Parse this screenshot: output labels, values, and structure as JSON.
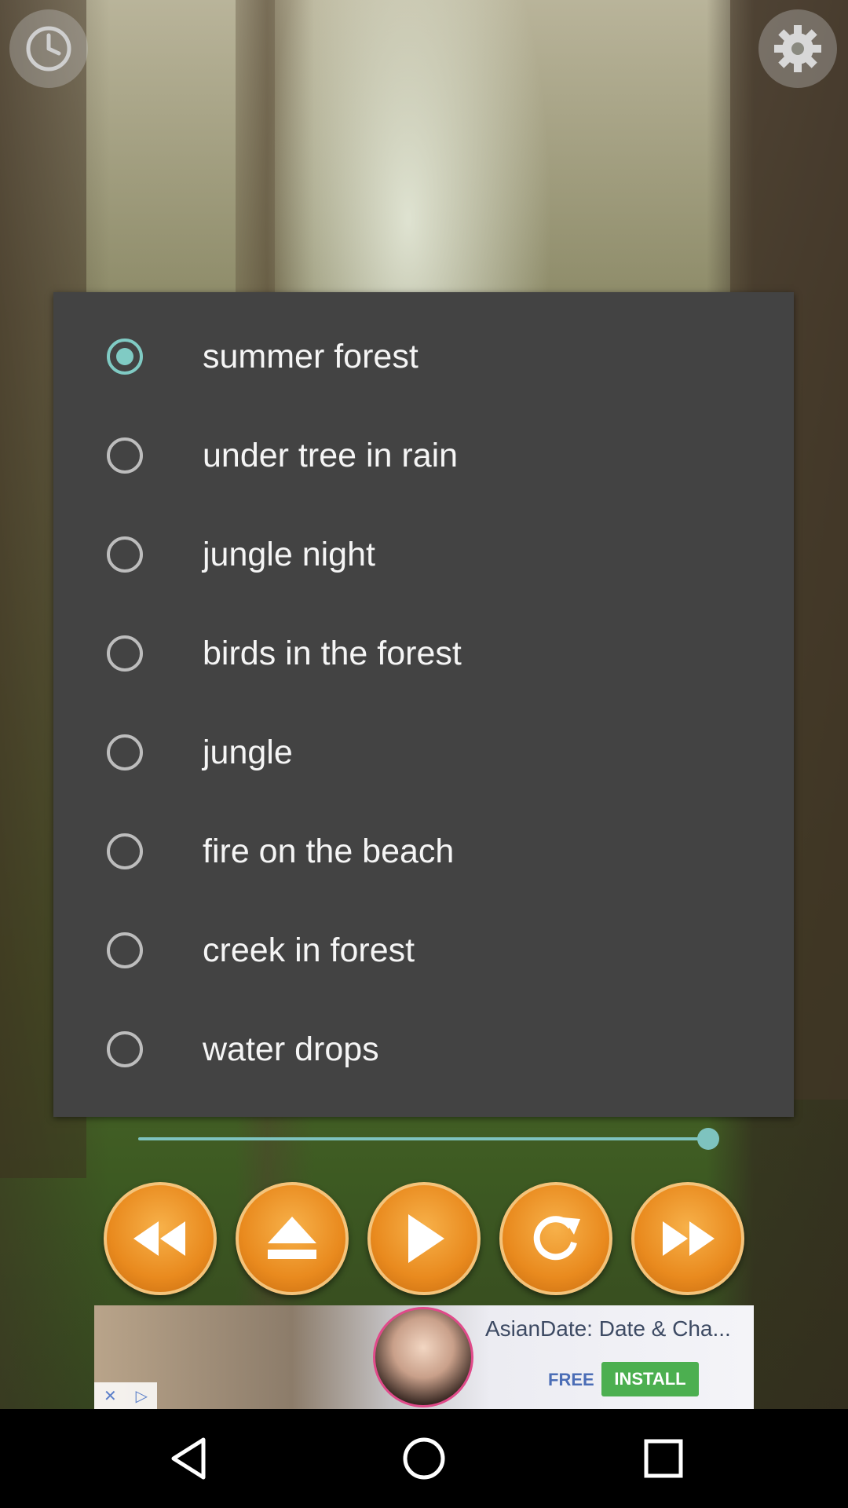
{
  "toolbar": {
    "timer_icon": "clock-icon",
    "settings_icon": "gear-icon"
  },
  "dialog": {
    "options": [
      {
        "label": "summer forest",
        "selected": true
      },
      {
        "label": "under tree in rain",
        "selected": false
      },
      {
        "label": "jungle night",
        "selected": false
      },
      {
        "label": "birds in the forest",
        "selected": false
      },
      {
        "label": "jungle",
        "selected": false
      },
      {
        "label": "fire on the beach",
        "selected": false
      },
      {
        "label": "creek in forest",
        "selected": false
      },
      {
        "label": "water drops",
        "selected": false
      }
    ]
  },
  "player": {
    "volume_fraction": 1.0,
    "controls": [
      "rewind-icon",
      "eject-icon",
      "play-icon",
      "repeat-icon",
      "fast-forward-icon"
    ]
  },
  "ad": {
    "title": "AsianDate: Date & Cha...",
    "free_label": "FREE",
    "install_label": "INSTALL"
  },
  "colors": {
    "accent": "#80cbc4",
    "dialog_bg": "#434343",
    "control_orange": "#e98a1e",
    "install_green": "#4caf50"
  }
}
